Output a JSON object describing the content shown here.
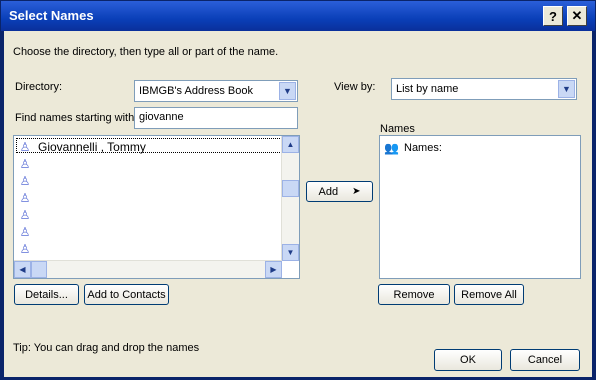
{
  "window": {
    "title": "Select Names",
    "help_label": "?",
    "close_label": "✕"
  },
  "instructions": "Choose the directory, then type all or part of the name.",
  "directory": {
    "label": "Directory:",
    "value": "IBMGB's Address Book"
  },
  "find": {
    "label": "Find names starting with:",
    "value": "giovanne"
  },
  "viewby": {
    "label": "View by:",
    "value": "List by name"
  },
  "results": {
    "items": [
      {
        "name": "Giovannelli , Tommy"
      },
      {
        "name": ""
      },
      {
        "name": ""
      },
      {
        "name": ""
      },
      {
        "name": ""
      },
      {
        "name": ""
      },
      {
        "name": ""
      }
    ]
  },
  "buttons": {
    "add": "Add",
    "details": "Details...",
    "add_to_contacts": "Add to Contacts",
    "remove": "Remove",
    "remove_all": "Remove All",
    "ok": "OK",
    "cancel": "Cancel"
  },
  "names_panel": {
    "label": "Names",
    "root_label": "Names:"
  },
  "tip": "Tip: You can drag and drop the names",
  "colors": {
    "titlebar": "#0a3fb8",
    "dialog_bg": "#ece9d8",
    "border": "#7f9db9",
    "icon": "#5b6fd6"
  }
}
